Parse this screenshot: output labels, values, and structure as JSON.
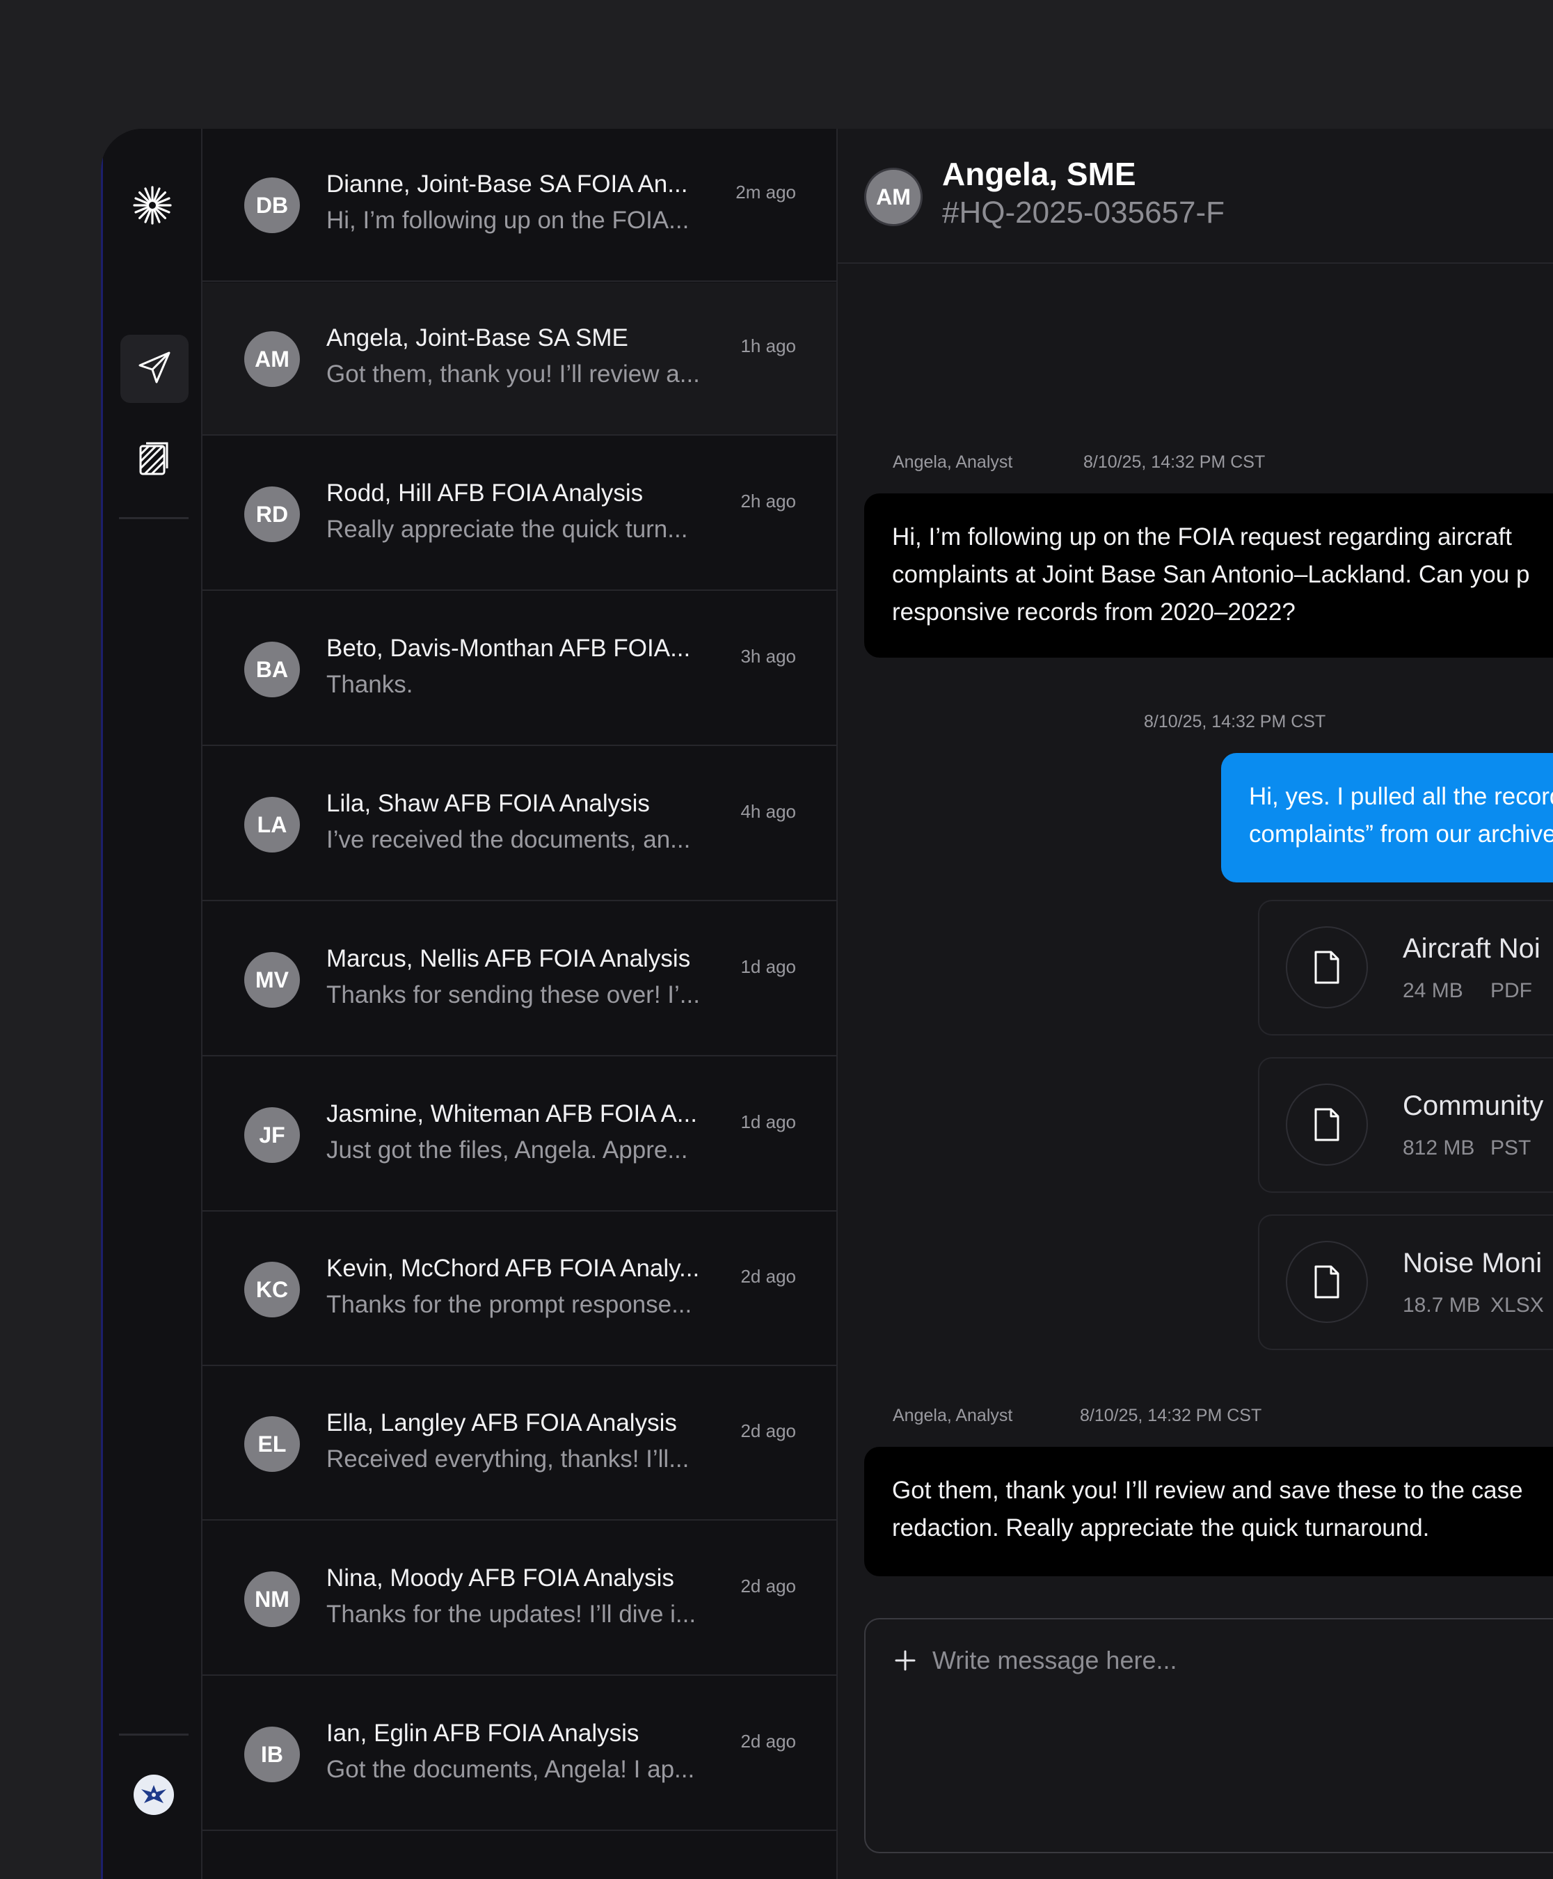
{
  "colors": {
    "page_bg": "#1f1f22",
    "panel_bg": "#111114",
    "chat_bg": "#17171a",
    "accent_blue": "#0a8cf0",
    "avatar_gray": "#7d7d82"
  },
  "rail": {
    "logo_icon": "starburst-icon",
    "nav": [
      {
        "icon": "send-icon",
        "active": true
      },
      {
        "icon": "documents-icon",
        "active": false
      }
    ],
    "badge_icon": "air-force-emblem-icon"
  },
  "conversations": [
    {
      "initials": "DB",
      "name": "Dianne, Joint-Base SA FOIA An...",
      "preview": "Hi, I’m following up on the FOIA...",
      "time": "2m ago"
    },
    {
      "initials": "AM",
      "name": "Angela, Joint-Base SA SME",
      "preview": "Got them, thank you! I’ll review a...",
      "time": "1h ago",
      "active": true
    },
    {
      "initials": "RD",
      "name": "Rodd, Hill AFB FOIA Analysis",
      "preview": "Really appreciate the quick turn...",
      "time": "2h ago"
    },
    {
      "initials": "BA",
      "name": "Beto, Davis-Monthan AFB FOIA...",
      "preview": "Thanks.",
      "time": "3h ago"
    },
    {
      "initials": "LA",
      "name": "Lila, Shaw AFB FOIA Analysis",
      "preview": "I’ve received the documents, an...",
      "time": "4h ago"
    },
    {
      "initials": "MV",
      "name": "Marcus, Nellis AFB FOIA Analysis",
      "preview": "Thanks for sending these over! I’...",
      "time": "1d ago"
    },
    {
      "initials": "JF",
      "name": "Jasmine, Whiteman AFB FOIA A...",
      "preview": "Just got the files, Angela. Appre...",
      "time": "1d ago"
    },
    {
      "initials": "KC",
      "name": "Kevin, McChord AFB FOIA Analy...",
      "preview": "Thanks for the prompt response...",
      "time": "2d ago"
    },
    {
      "initials": "EL",
      "name": "Ella, Langley AFB FOIA Analysis",
      "preview": "Received everything, thanks! I’ll...",
      "time": "2d ago"
    },
    {
      "initials": "NM",
      "name": "Nina, Moody AFB FOIA Analysis",
      "preview": "Thanks for the updates! I’ll dive i...",
      "time": "2d ago"
    },
    {
      "initials": "IB",
      "name": "Ian, Eglin AFB FOIA Analysis",
      "preview": "Got the documents, Angela! I ap...",
      "time": "2d ago"
    }
  ],
  "chat": {
    "header": {
      "initials": "AM",
      "title": "Angela, SME",
      "case_id": "#HQ-2025-035657-F"
    },
    "msg1": {
      "sender": "Angela, Analyst",
      "timestamp": "8/10/25, 14:32 PM CST",
      "lines": [
        "Hi, I’m following up on the FOIA request regarding aircraft",
        "complaints at Joint Base San Antonio–Lackland. Can you p",
        "responsive records from 2020–2022?"
      ]
    },
    "msg2": {
      "timestamp": "8/10/25, 14:32 PM CST",
      "lines": [
        "Hi, yes. I pulled all the records that r",
        "complaints” from our archive. There"
      ]
    },
    "attachments": [
      {
        "name": "Aircraft Noi",
        "size": "24 MB",
        "type": "PDF",
        "icon": "file-icon"
      },
      {
        "name": "Community",
        "size": "812 MB",
        "type": "PST",
        "icon": "file-icon"
      },
      {
        "name": "Noise Moni",
        "size": "18.7 MB",
        "type": "XLSX",
        "icon": "file-icon"
      }
    ],
    "msg3": {
      "sender": "Angela, Analyst",
      "timestamp": "8/10/25, 14:32 PM CST",
      "lines": [
        "Got them, thank you! I’ll review and save these to the case",
        "redaction. Really appreciate the quick turnaround."
      ]
    },
    "composer": {
      "placeholder": "Write message here...",
      "value": ""
    }
  }
}
